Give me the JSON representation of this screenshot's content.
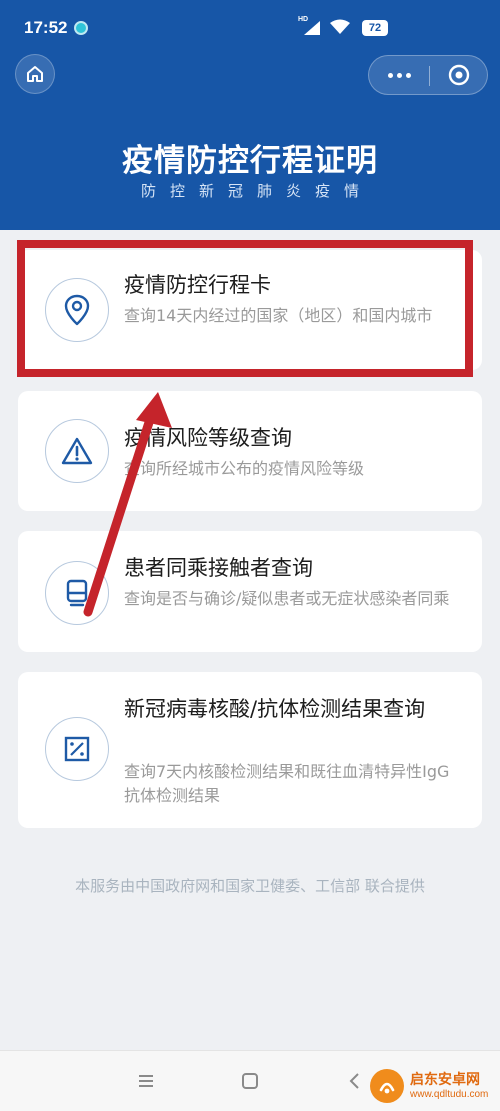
{
  "status_bar": {
    "time": "17:52",
    "network_label": "HD",
    "battery": "72"
  },
  "header": {
    "title": "疫情防控行程证明",
    "subtitle": "防控新冠肺炎疫情"
  },
  "cards": [
    {
      "title": "疫情防控行程卡",
      "desc": "查询14天内经过的国家（地区）和国内城市",
      "icon": "location-pin-icon"
    },
    {
      "title": "疫情风险等级查询",
      "desc": "查询所经城市公布的疫情风险等级",
      "icon": "warning-icon"
    },
    {
      "title": "患者同乘接触者查询",
      "desc": "查询是否与确诊/疑似患者或无症状感染者同乘",
      "icon": "train-icon"
    },
    {
      "title": "新冠病毒核酸/抗体检测结果查询",
      "desc": "查询7天内核酸检测结果和既往血清特异性IgG抗体检测结果",
      "icon": "test-report-icon"
    }
  ],
  "footer": {
    "note": "本服务由中国政府网和国家卫健委、工信部 联合提供"
  },
  "watermark": {
    "name": "启东安卓网",
    "url": "www.qdltudu.com"
  },
  "colors": {
    "header_blue": "#1756a7",
    "highlight_red": "#c5242b",
    "icon_blue": "#1e5aa6"
  }
}
